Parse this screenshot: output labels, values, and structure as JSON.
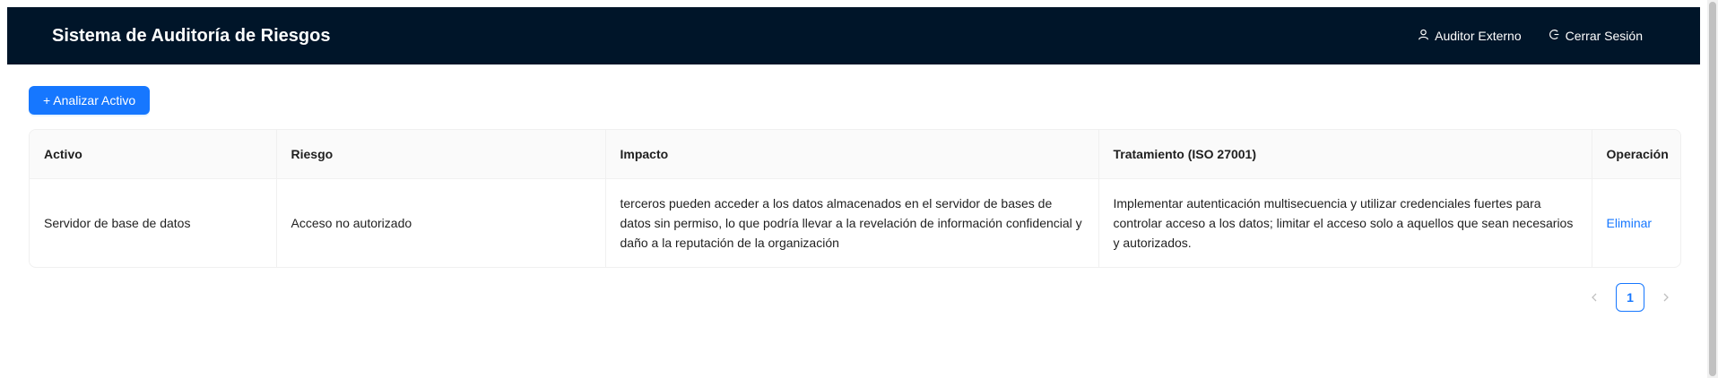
{
  "header": {
    "title": "Sistema de Auditoría de Riesgos",
    "user_label": "Auditor Externo",
    "logout_label": "Cerrar Sesión",
    "user_icon": "user-icon",
    "logout_icon": "logout-icon"
  },
  "toolbar": {
    "add_label": "+ Analizar Activo"
  },
  "table": {
    "columns": [
      "Activo",
      "Riesgo",
      "Impacto",
      "Tratamiento (ISO 27001)",
      "Operación"
    ],
    "rows": [
      {
        "activo": "Servidor de base de datos",
        "riesgo": "Acceso no autorizado",
        "impacto": "terceros pueden acceder a los datos almacenados en el servidor de bases de datos sin permiso, lo que podría llevar a la revelación de información confidencial y daño a la reputación de la organización",
        "tratamiento": "Implementar autenticación multisecuencia y utilizar credenciales fuertes para controlar acceso a los datos; limitar el acceso solo a aquellos que sean necesarios y autorizados.",
        "operacion": "Eliminar"
      }
    ]
  },
  "pagination": {
    "current_page": "1"
  },
  "colors": {
    "header_bg": "#001529",
    "primary": "#1677ff"
  }
}
